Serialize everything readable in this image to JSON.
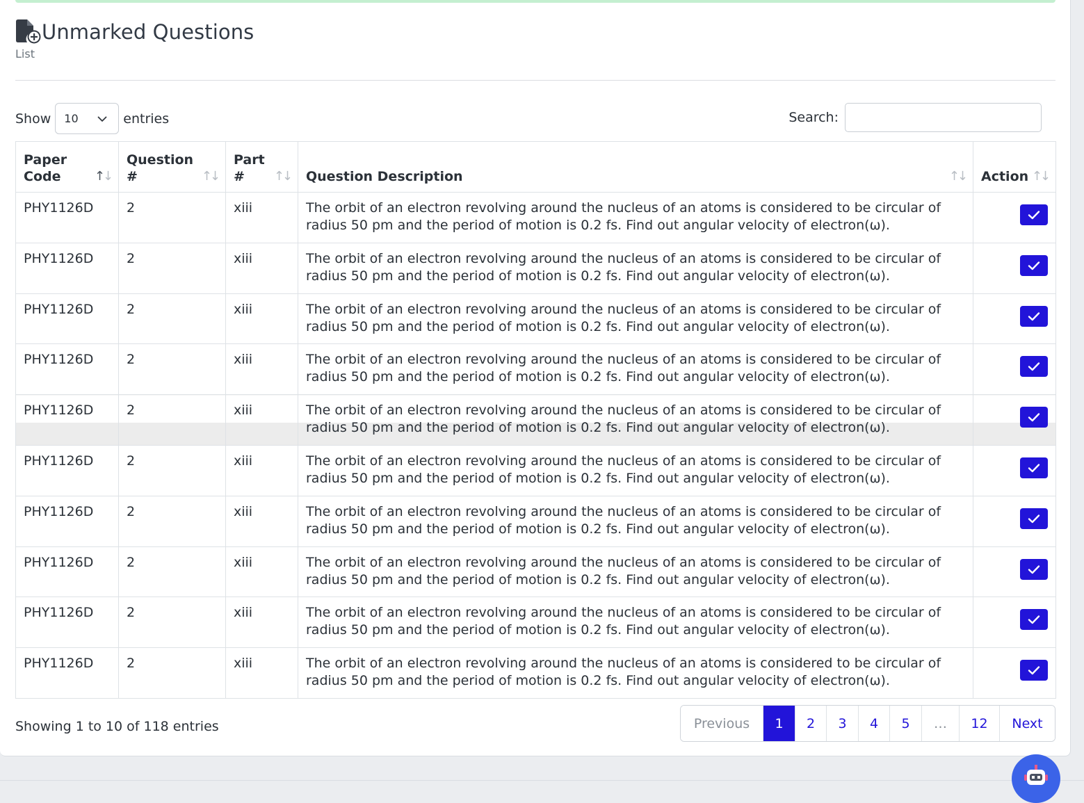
{
  "page": {
    "title": "Unmarked Questions",
    "subtitle": "List",
    "accent_color": "#2214d9"
  },
  "length_control": {
    "prefix": "Show",
    "selected": "10",
    "suffix": "entries"
  },
  "search": {
    "label": "Search:",
    "value": "",
    "placeholder": ""
  },
  "table": {
    "columns": [
      {
        "label": "Paper Code"
      },
      {
        "label": "Question #"
      },
      {
        "label": "Part #"
      },
      {
        "label": "Question Description"
      },
      {
        "label": "Action"
      }
    ],
    "rows": [
      {
        "paper_code": "PHY1126D",
        "question": "2",
        "part": "xiii",
        "description": "The orbit of an electron revolving around the nucleus of an atoms is considered to be circular of radius 50 pm and the period of motion is 0.2 fs. Find out angular velocity of electron(ω)."
      },
      {
        "paper_code": "PHY1126D",
        "question": "2",
        "part": "xiii",
        "description": "The orbit of an electron revolving around the nucleus of an atoms is considered to be circular of radius 50 pm and the period of motion is 0.2 fs. Find out angular velocity of electron(ω)."
      },
      {
        "paper_code": "PHY1126D",
        "question": "2",
        "part": "xiii",
        "description": "The orbit of an electron revolving around the nucleus of an atoms is considered to be circular of radius 50 pm and the period of motion is 0.2 fs. Find out angular velocity of electron(ω)."
      },
      {
        "paper_code": "PHY1126D",
        "question": "2",
        "part": "xiii",
        "description": "The orbit of an electron revolving around the nucleus of an atoms is considered to be circular of radius 50 pm and the period of motion is 0.2 fs. Find out angular velocity of electron(ω)."
      },
      {
        "paper_code": "PHY1126D",
        "question": "2",
        "part": "xiii",
        "description": "The orbit of an electron revolving around the nucleus of an atoms is considered to be circular of radius 50 pm and the period of motion is 0.2 fs. Find out angular velocity of electron(ω)."
      },
      {
        "paper_code": "PHY1126D",
        "question": "2",
        "part": "xiii",
        "description": "The orbit of an electron revolving around the nucleus of an atoms is considered to be circular of radius 50 pm and the period of motion is 0.2 fs. Find out angular velocity of electron(ω)."
      },
      {
        "paper_code": "PHY1126D",
        "question": "2",
        "part": "xiii",
        "description": "The orbit of an electron revolving around the nucleus of an atoms is considered to be circular of radius 50 pm and the period of motion is 0.2 fs. Find out angular velocity of electron(ω)."
      },
      {
        "paper_code": "PHY1126D",
        "question": "2",
        "part": "xiii",
        "description": "The orbit of an electron revolving around the nucleus of an atoms is considered to be circular of radius 50 pm and the period of motion is 0.2 fs. Find out angular velocity of electron(ω)."
      },
      {
        "paper_code": "PHY1126D",
        "question": "2",
        "part": "xiii",
        "description": "The orbit of an electron revolving around the nucleus of an atoms is considered to be circular of radius 50 pm and the period of motion is 0.2 fs. Find out angular velocity of electron(ω)."
      },
      {
        "paper_code": "PHY1126D",
        "question": "2",
        "part": "xiii",
        "description": "The orbit of an electron revolving around the nucleus of an atoms is considered to be circular of radius 50 pm and the period of motion is 0.2 fs. Find out angular velocity of electron(ω)."
      }
    ]
  },
  "footer": {
    "info": "Showing 1 to 10 of 118 entries",
    "pagination": {
      "previous": "Previous",
      "pages": [
        "1",
        "2",
        "3",
        "4",
        "5",
        "…",
        "12"
      ],
      "active": "1",
      "next": "Next"
    }
  }
}
